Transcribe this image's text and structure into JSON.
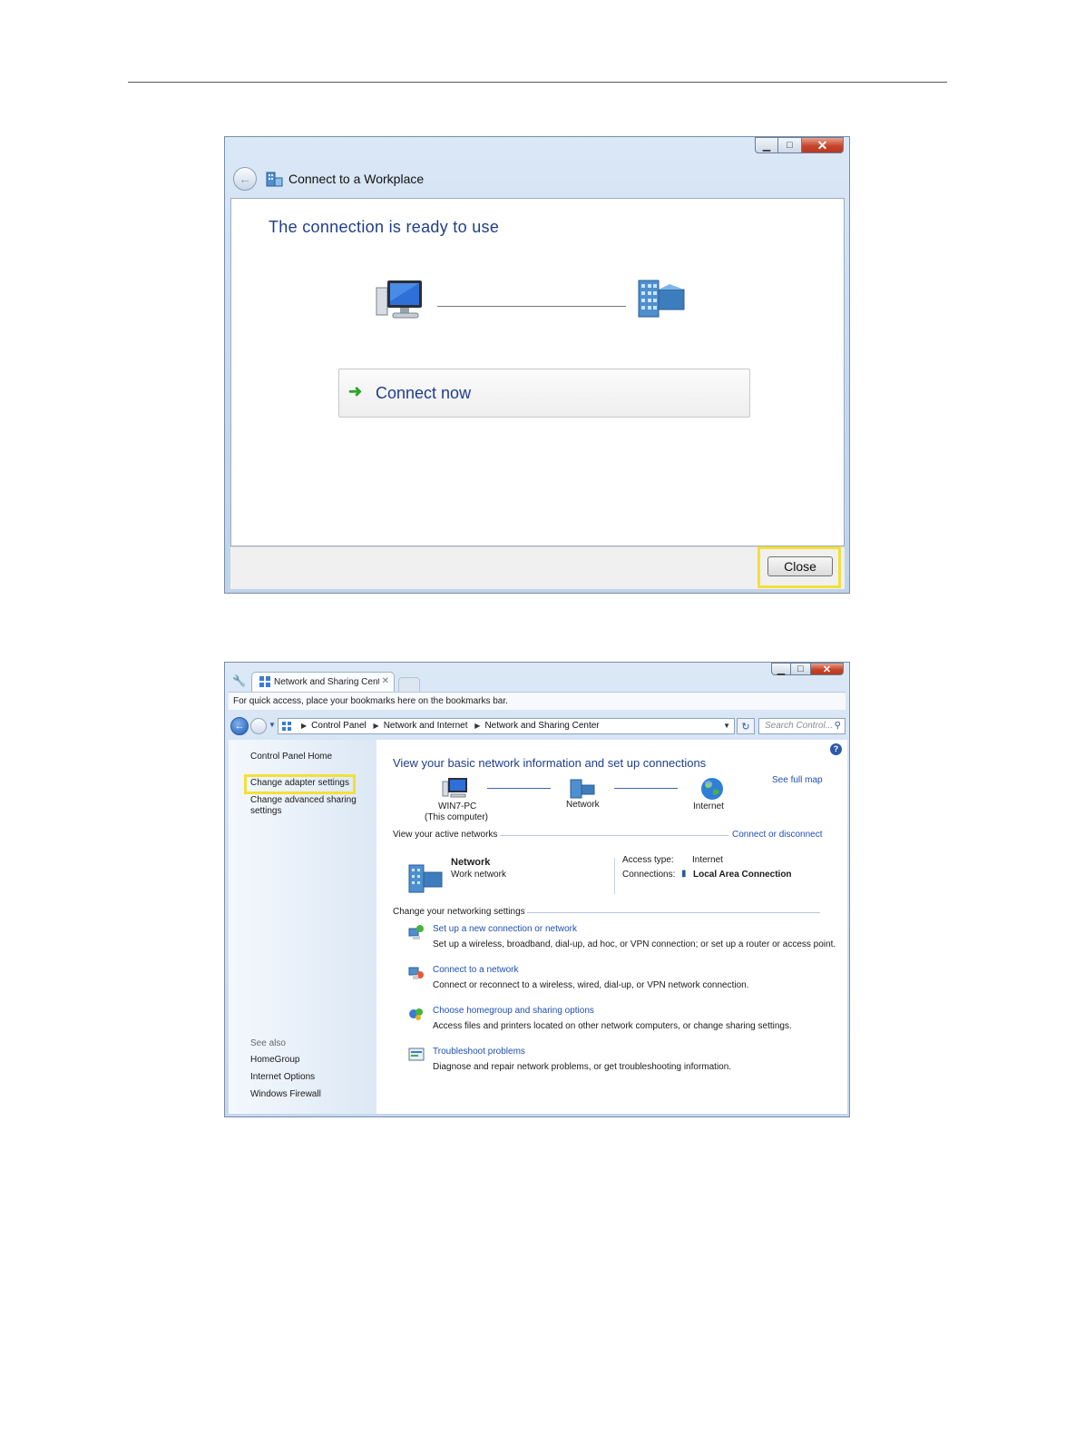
{
  "dialog1": {
    "title": "Connect to a Workplace",
    "heading": "The connection is ready to use",
    "connect_now": "Connect now",
    "close": "Close"
  },
  "dialog2": {
    "tab_title": "Network and Sharing Cent",
    "bookmarks_hint": "For quick access, place your bookmarks here on the bookmarks bar.",
    "breadcrumb": [
      "Control Panel",
      "Network and Internet",
      "Network and Sharing Center"
    ],
    "search_placeholder": "Search Control...",
    "sidebar": {
      "home": "Control Panel Home",
      "adapter": "Change adapter settings",
      "advanced_line1": "Change advanced sharing",
      "advanced_line2": "settings",
      "see_also": "See also",
      "see_also_items": [
        "HomeGroup",
        "Internet Options",
        "Windows Firewall"
      ]
    },
    "heading": "View your basic network information and set up connections",
    "see_full_map": "See full map",
    "map": {
      "pc_name": "WIN7-PC",
      "pc_sub": "(This computer)",
      "network": "Network",
      "internet": "Internet"
    },
    "active_networks": {
      "label": "View your active networks",
      "connect_link": "Connect or disconnect",
      "network_name": "Network",
      "network_type": "Work network",
      "access_type_label": "Access type:",
      "access_type_value": "Internet",
      "connections_label": "Connections:",
      "connections_value": "Local Area Connection"
    },
    "settings": {
      "label": "Change your networking settings",
      "tasks": [
        {
          "link": "Set up a new connection or network",
          "desc": "Set up a wireless, broadband, dial-up, ad hoc, or VPN connection; or set up a router or access point.",
          "icon": "network-setup-icon"
        },
        {
          "link": "Connect to a network",
          "desc": "Connect or reconnect to a wireless, wired, dial-up, or VPN network connection.",
          "icon": "connect-network-icon"
        },
        {
          "link": "Choose homegroup and sharing options",
          "desc": "Access files and printers located on other network computers, or change sharing settings.",
          "icon": "homegroup-icon"
        },
        {
          "link": "Troubleshoot problems",
          "desc": "Diagnose and repair network problems, or get troubleshooting information.",
          "icon": "troubleshoot-icon"
        }
      ]
    }
  },
  "colors": {
    "highlight": "#f4df3a",
    "link": "#1f4fb4",
    "heading": "#1e3e8c"
  }
}
